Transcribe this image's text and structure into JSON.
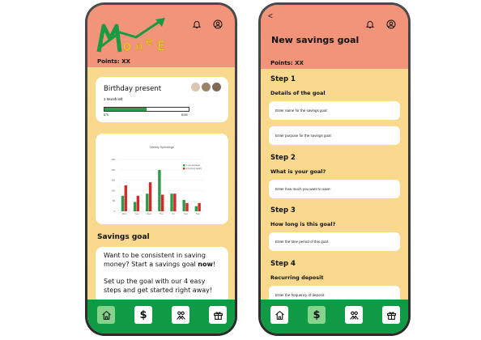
{
  "left": {
    "points": "Points: XX",
    "goal_card": {
      "title": "Birthday present",
      "subtitle": "1 Month left",
      "progress": 0.5,
      "min_label": "$75",
      "max_label": "$150"
    },
    "chart_data": {
      "type": "bar",
      "title": "Weekly Spendings",
      "categories": [
        "Mon",
        "Tue",
        "Wed",
        "Thu",
        "Fri",
        "Sat",
        "Sun"
      ],
      "series": [
        {
          "name": "1 (on average)",
          "color": "#2e9b4c",
          "values": [
            75,
            45,
            85,
            200,
            85,
            55,
            25
          ]
        },
        {
          "name": "2 (current week)",
          "color": "#d62828",
          "values": [
            125,
            75,
            140,
            80,
            85,
            40,
            40
          ]
        }
      ],
      "yticks": [
        "0",
        "50",
        "100",
        "150",
        "200",
        "250"
      ],
      "ylim": [
        0,
        250
      ]
    },
    "savings_heading": "Savings goal",
    "info_line1": "Want to be consistent in saving money? Start a savings goal ",
    "info_bold": "now",
    "info_line1_end": "!",
    "info_line2": "Set up the goal with our 4 easy steps and get started right away!"
  },
  "right": {
    "back": "<",
    "title": "New savings goal",
    "points": "Points: XX",
    "steps": [
      {
        "label": "Step 1",
        "sub": "Details of the goal"
      },
      {
        "label": "Step 2",
        "sub": "What is your goal?"
      },
      {
        "label": "Step 3",
        "sub": "How long is this goal?"
      },
      {
        "label": "Step 4",
        "sub": "Recurring deposit"
      }
    ],
    "fields": [
      "Enter name for the savings goal:",
      "Enter purpose for the savings goal:",
      "Enter how much you want to save:",
      "Enter the time period of this goal:",
      "Enter the frequency of deposit:"
    ]
  },
  "nav": {
    "dollar": "$"
  },
  "icons": [
    "bell-icon",
    "profile-icon",
    "home-icon",
    "dollar-icon",
    "community-icon",
    "gift-icon",
    "back-arrow-icon"
  ],
  "colors": {
    "header": "#f19479",
    "body": "#f9d98d",
    "nav": "#109a45",
    "nav_active": "#86d38b"
  }
}
